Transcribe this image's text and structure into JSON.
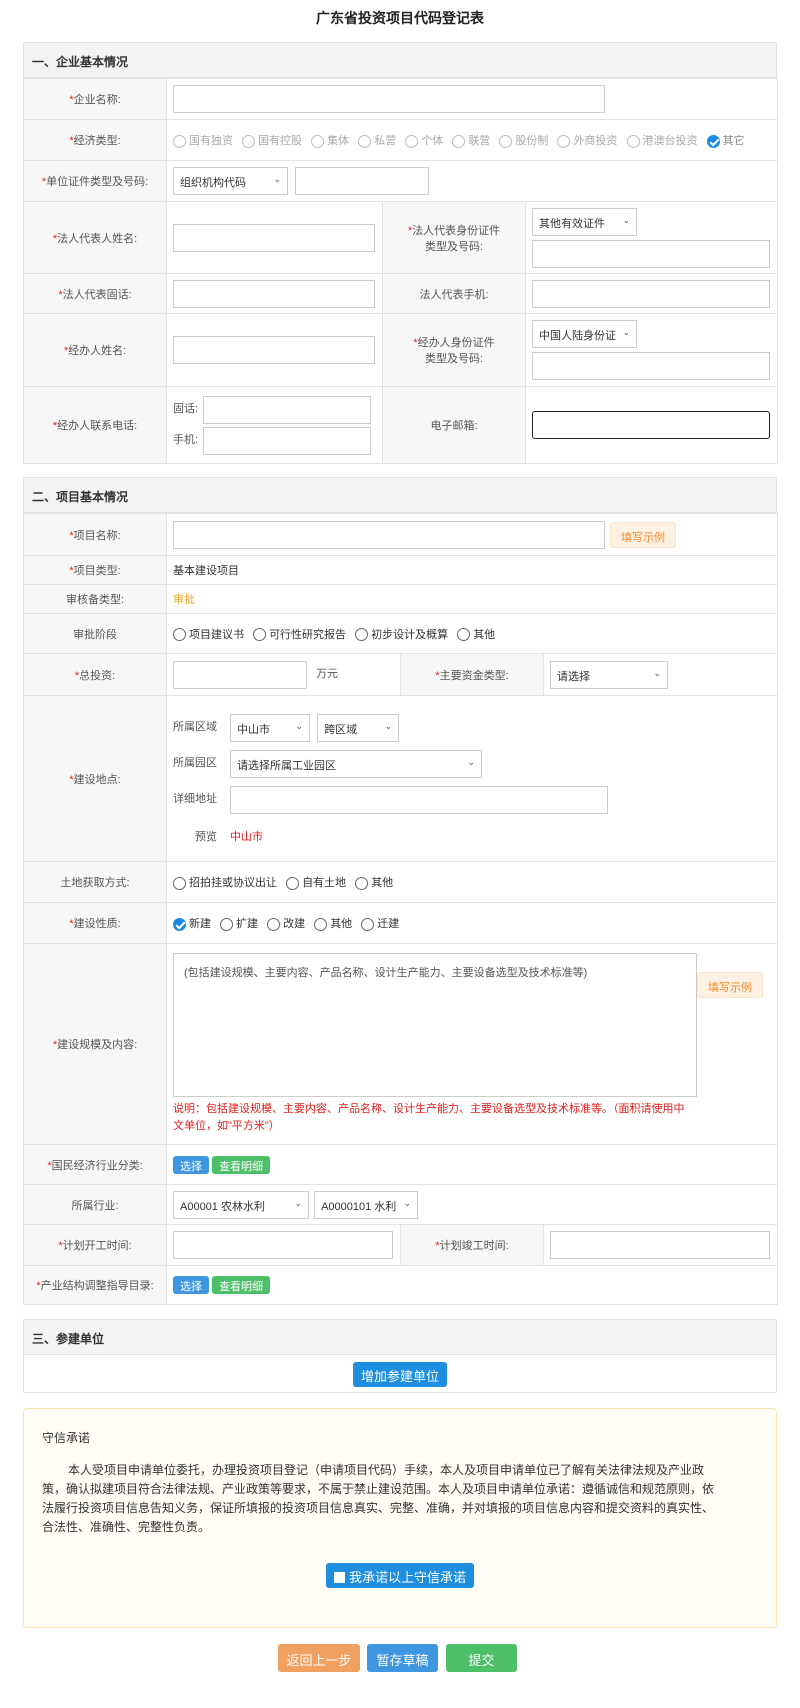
{
  "title": "广东省投资项目代码登记表",
  "section1": {
    "heading": "一、企业基本情况",
    "company_name_label": "企业名称:",
    "economy_type_label": "经济类型:",
    "economy_options": [
      "国有独资",
      "国有控股",
      "集体",
      "私营",
      "个体",
      "联营",
      "股份制",
      "外商投资",
      "港澳台投资",
      "其它"
    ],
    "id_type_label": "单位证件类型及号码:",
    "id_type_value": "组织机构代码",
    "legal_name_label": "法人代表人姓名:",
    "legal_id_label_1": "法人代表身份证件",
    "legal_id_label_2": "类型及号码:",
    "legal_id_type_value": "其他有效证件",
    "legal_phone_label": "法人代表固话:",
    "legal_mobile_label": "法人代表手机:",
    "agent_name_label": "经办人姓名:",
    "agent_id_label_1": "经办人身份证件",
    "agent_id_label_2": "类型及号码:",
    "agent_id_type_value": "中国人陆身份证",
    "agent_contact_label": "经办人联系电话:",
    "landline_label": "固话:",
    "mobile_label": "手机:",
    "email_label": "电子邮箱:"
  },
  "section2": {
    "heading": "二、项目基本情况",
    "project_name_label": "项目名称:",
    "example_button": "填写示例",
    "project_type_label": "项目类型:",
    "project_type_value": "基本建设项目",
    "review_type_label": "审核备类型:",
    "review_type_value": "审批",
    "stage_label": "审批阶段",
    "stage_options": [
      "项目建议书",
      "可行性研究报告",
      "初步设计及概算",
      "其他"
    ],
    "total_invest_label": "总投资:",
    "total_invest_unit": "万元",
    "fund_type_label": "主要资金类型:",
    "fund_type_value": "请选择",
    "location_label": "建设地点:",
    "region_label": "所属区域",
    "region_value": "中山市",
    "cross_region_value": "跨区域",
    "park_label": "所属园区",
    "park_value": "请选择所属工业园区",
    "address_label": "详细地址",
    "preview_label": "预览",
    "preview_value": "中山市",
    "land_label": "土地获取方式:",
    "land_options": [
      "招拍挂或协议出让",
      "自有土地",
      "其他"
    ],
    "nature_label": "建设性质:",
    "nature_options": [
      "新建",
      "扩建",
      "改建",
      "其他",
      "迁建"
    ],
    "scale_label": "建设规模及内容:",
    "scale_placeholder": "(包括建设规模、主要内容、产品名称、设计生产能力、主要设备选型及技术标准等)",
    "scale_note_1": "说明：包括建设规模、主要内容、产品名称、设计生产能力、主要设备选型及技术标准等。（面积请使用中",
    "scale_note_2": "文单位，如\"平方米\"）",
    "industry_class_label": "国民经济行业分类:",
    "select_button": "选择",
    "view_detail_button": "查看明细",
    "industry_label": "所属行业:",
    "industry_value_1": "A00001 农林水利",
    "industry_value_2": "A0000101 水利",
    "start_label": "计划开工时间:",
    "end_label": "计划竣工时间:",
    "guide_label": "产业结构调整指导目录:"
  },
  "section3": {
    "heading": "三、参建单位",
    "add_button": "增加参建单位"
  },
  "promise": {
    "heading": "守信承诺",
    "line1": "本人受项目申请单位委托，办理投资项目登记（申请项目代码）手续，本人及项目申请单位已了解有关法律法规及产业政",
    "line2": "策，确认拟建项目符合法律法规、产业政策等要求，不属于禁止建设范围。本人及项目申请单位承诺：遵循诚信和规范原则，依",
    "line3": "法履行投资项目信息告知义务，保证所填报的投资项目信息真实、完整、准确，并对填报的项目信息内容和提交资料的真实性、",
    "line4": "合法性、准确性、完整性负责。",
    "agree_button": "我承诺以上守信承诺"
  },
  "footer": {
    "back": "返回上一步",
    "save": "暂存草稿",
    "submit": "提交"
  },
  "colors": {
    "blue": "#3e97e0",
    "green": "#4cbf68",
    "orange": "#f0a060",
    "red": "#e02020"
  }
}
